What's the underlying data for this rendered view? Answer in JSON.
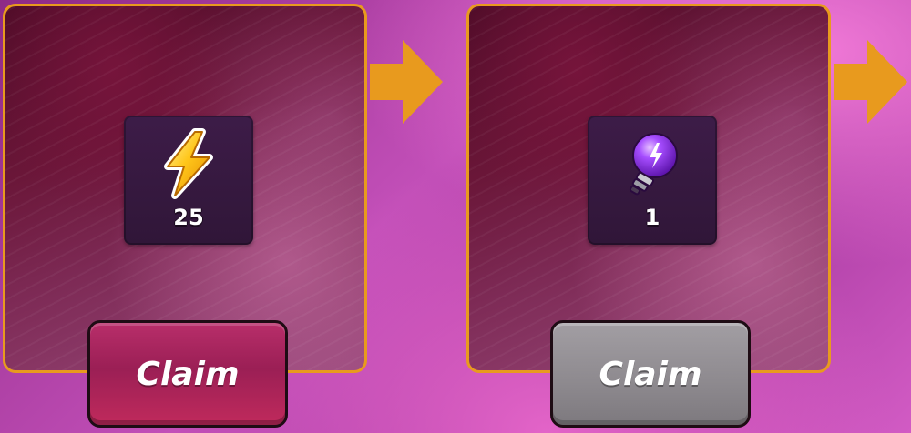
{
  "rewards": [
    {
      "item_icon": "lightning-bolt-icon",
      "count": "25",
      "claim_label": "Claim",
      "claim_state": "active",
      "claim_color": "#a82460"
    },
    {
      "item_icon": "purple-lightbulb-icon",
      "count": "1",
      "claim_label": "Claim",
      "claim_state": "disabled",
      "claim_color": "#8f8b90"
    }
  ],
  "colors": {
    "panel_border": "#e89a1e",
    "arrow": "#e89a1e",
    "background": "#b545ac"
  }
}
